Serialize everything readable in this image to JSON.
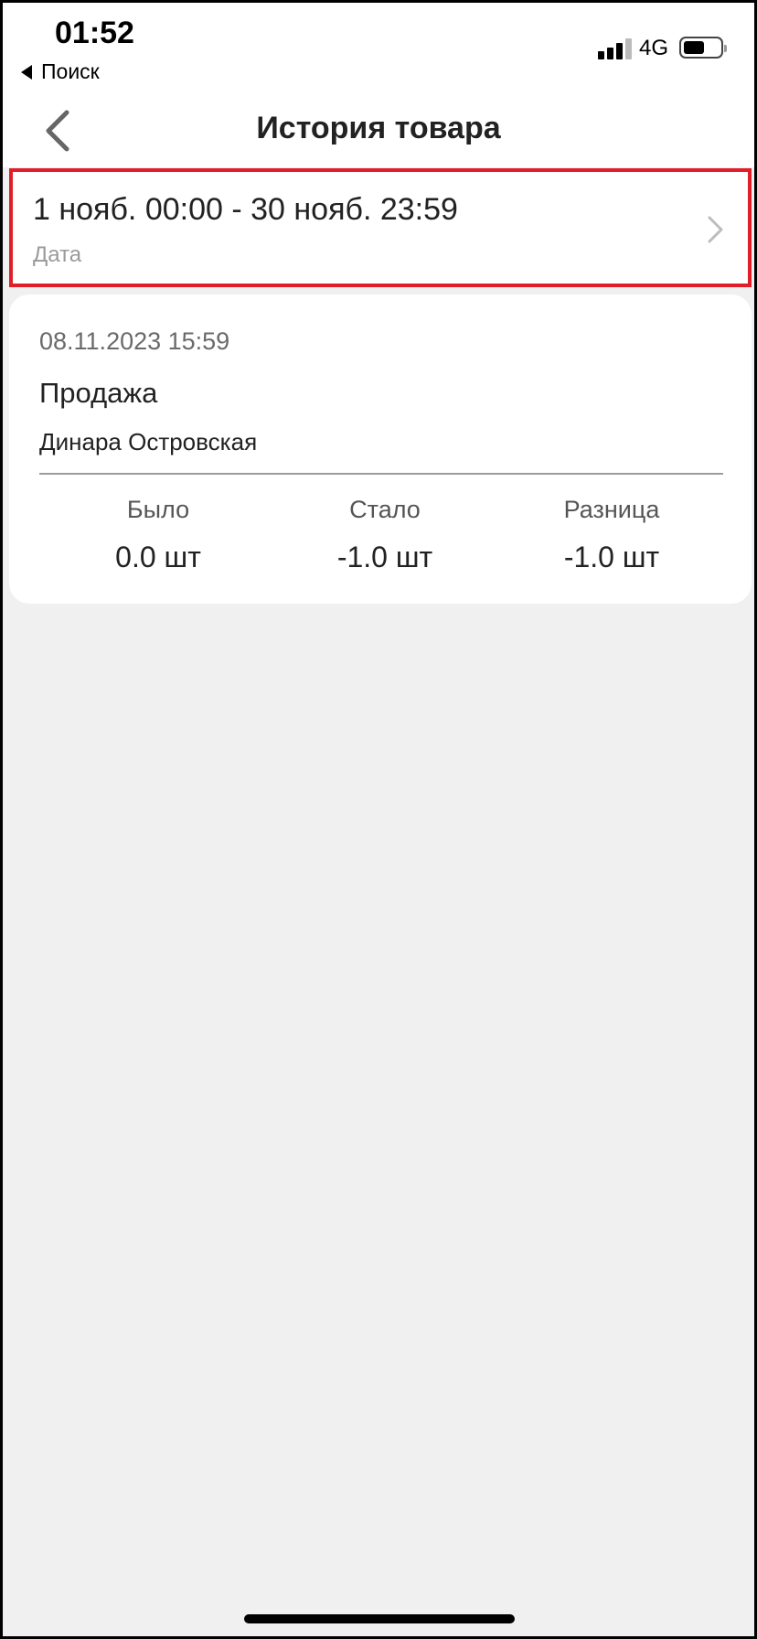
{
  "status_bar": {
    "time": "01:52",
    "back_app_label": "Поиск",
    "network": "4G",
    "battery_level": 0.55
  },
  "header": {
    "title": "История товара"
  },
  "date_filter": {
    "value": "1 нояб. 00:00 - 30 нояб. 23:59",
    "label": "Дата",
    "highlight_color": "#e01e2a"
  },
  "entries": [
    {
      "datetime": "08.11.2023 15:59",
      "type": "Продажа",
      "user": "Динара Островская",
      "stats": {
        "before_label": "Было",
        "before_value": "0.0 шт",
        "after_label": "Стало",
        "after_value": "-1.0 шт",
        "diff_label": "Разница",
        "diff_value": "-1.0 шт"
      }
    }
  ]
}
